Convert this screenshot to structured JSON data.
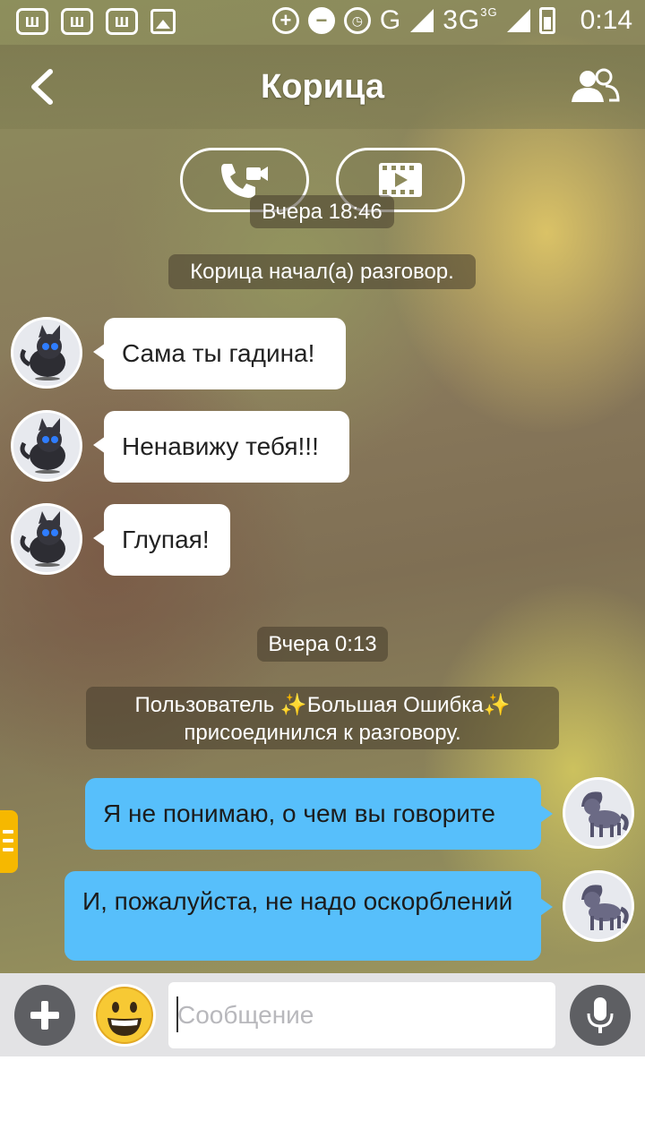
{
  "status_bar": {
    "app_icons": [
      "ш",
      "ш",
      "ш"
    ],
    "network": "G",
    "network2": "3G",
    "network2_sup": "3G",
    "time": "0:14"
  },
  "header": {
    "title": "Корица",
    "back_icon": "chevron-left-icon",
    "members_icon": "group-icon"
  },
  "call_buttons": {
    "voice_icon": "phone-video-icon",
    "screening_icon": "film-play-icon"
  },
  "chat": {
    "timestamp1": "Вчера 18:46",
    "system1": "Корица начал(а) разговор.",
    "incoming": [
      {
        "text": "Сама ты гадина!"
      },
      {
        "text": "Ненавижу тебя!!!"
      },
      {
        "text": "Глупая!"
      }
    ],
    "timestamp2": "Вчера 0:13",
    "system2_line1_prefix": "Пользователь ",
    "system2_line1_name": "Большая Ошибка",
    "system2_line2": "присоединился к разговору.",
    "outgoing": [
      {
        "text": "Я не понимаю, о чем вы говорите"
      },
      {
        "text": "И, пожалуйста, не надо оскорблений"
      }
    ]
  },
  "input_bar": {
    "placeholder": "Сообщение",
    "add_icon": "plus-icon",
    "emoji_icon": "smile-emoji-icon",
    "mic_icon": "microphone-icon"
  },
  "colors": {
    "outgoing_bubble": "#57bffb",
    "incoming_bubble": "#ffffff",
    "side_tab": "#f6b800"
  }
}
